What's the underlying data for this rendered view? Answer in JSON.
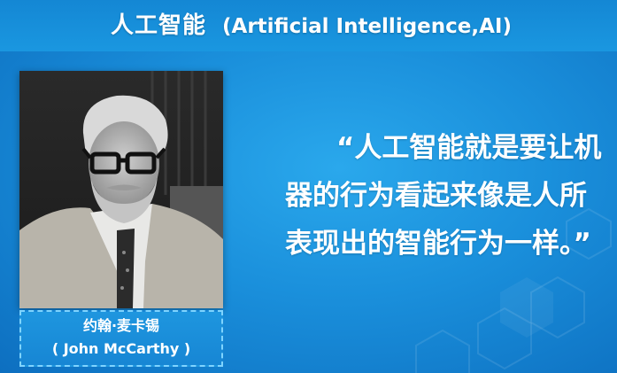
{
  "slide": {
    "title_cn": "人工智能",
    "title_en": "(Artificial Intelligence,AI)"
  },
  "portrait": {
    "name_cn": "约翰·麦卡锡",
    "name_en": "( John McCarthy )"
  },
  "quote": {
    "line1": "“人工智能就是要让机",
    "line2": "器的行为看起来像是人所",
    "line3": "表现出的智能行为一样。”"
  },
  "colors": {
    "background": "#1a8fdb",
    "caption_border": "#7fd4ff",
    "text": "#ffffff"
  }
}
